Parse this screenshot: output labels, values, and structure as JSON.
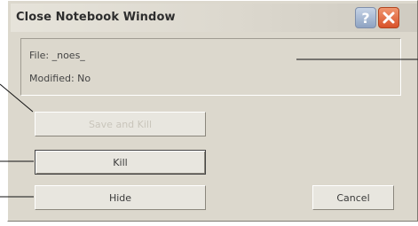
{
  "window": {
    "title": "Close Notebook Window"
  },
  "titlebar_buttons": {
    "help_glyph": "?",
    "close_icon": "close-icon"
  },
  "info": {
    "file_line": "File: _noes_",
    "modified_line": "Modified: No"
  },
  "buttons": {
    "save_and_kill": "Save and Kill",
    "kill": "Kill",
    "hide": "Hide",
    "cancel": "Cancel"
  },
  "colors": {
    "dialog_bg": "#dcd8cd",
    "close_button": "#d8522a",
    "help_button": "#8ea3c2"
  }
}
